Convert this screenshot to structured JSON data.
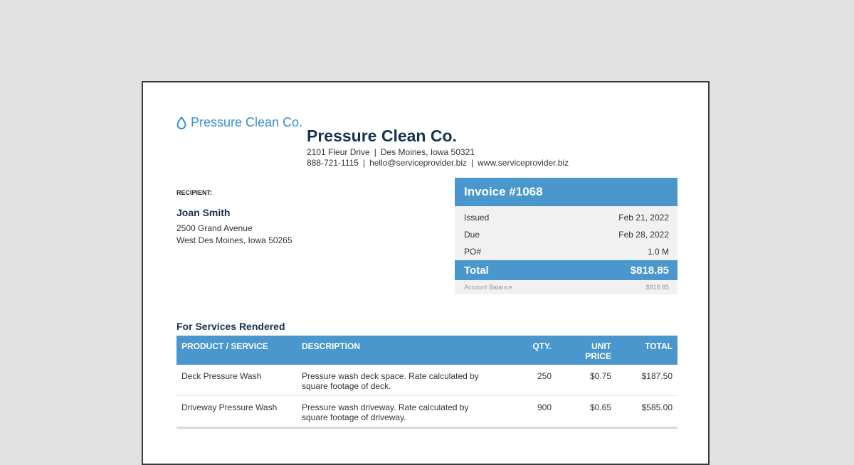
{
  "logo": {
    "text": "Pressure Clean Co.",
    "icon": "water-drop-icon"
  },
  "company": {
    "name": "Pressure Clean Co.",
    "address": "2101 Fleur Drive",
    "city": "Des Moines, Iowa 50321",
    "phone": "888-721-1115",
    "email": "hello@serviceprovider.biz",
    "website": "www.serviceprovider.biz"
  },
  "recipient": {
    "label": "RECIPIENT:",
    "name": "Joan Smith",
    "address1": "2500 Grand Avenue",
    "address2": "West Des Moines, Iowa 50265"
  },
  "invoice": {
    "title": "Invoice #1068",
    "rows": [
      {
        "label": "Issued",
        "value": "Feb 21, 2022"
      },
      {
        "label": "Due",
        "value": "Feb 28, 2022"
      },
      {
        "label": "PO#",
        "value": "1.0 M"
      }
    ],
    "total_label": "Total",
    "total_value": "$818.85",
    "balance_label": "Account Balance",
    "balance_value": "$818.85"
  },
  "services": {
    "title": "For Services Rendered",
    "headers": {
      "product": "PRODUCT / SERVICE",
      "description": "DESCRIPTION",
      "qty": "QTY.",
      "unit_price_1": "UNIT",
      "unit_price_2": "PRICE",
      "total": "TOTAL"
    },
    "items": [
      {
        "product": "Deck Pressure Wash",
        "description_1": "Pressure wash deck space. Rate calculated by",
        "description_2": "square footage of deck.",
        "qty": "250",
        "unit_price": "$0.75",
        "total": "$187.50"
      },
      {
        "product": "Driveway Pressure Wash",
        "description_1": "Pressure wash driveway. Rate calculated by",
        "description_2": "square footage of driveway.",
        "qty": "900",
        "unit_price": "$0.65",
        "total": "$585.00"
      }
    ]
  },
  "colors": {
    "accent": "#4997cc",
    "heading": "#15324f",
    "logo": "#3a8fcf"
  }
}
